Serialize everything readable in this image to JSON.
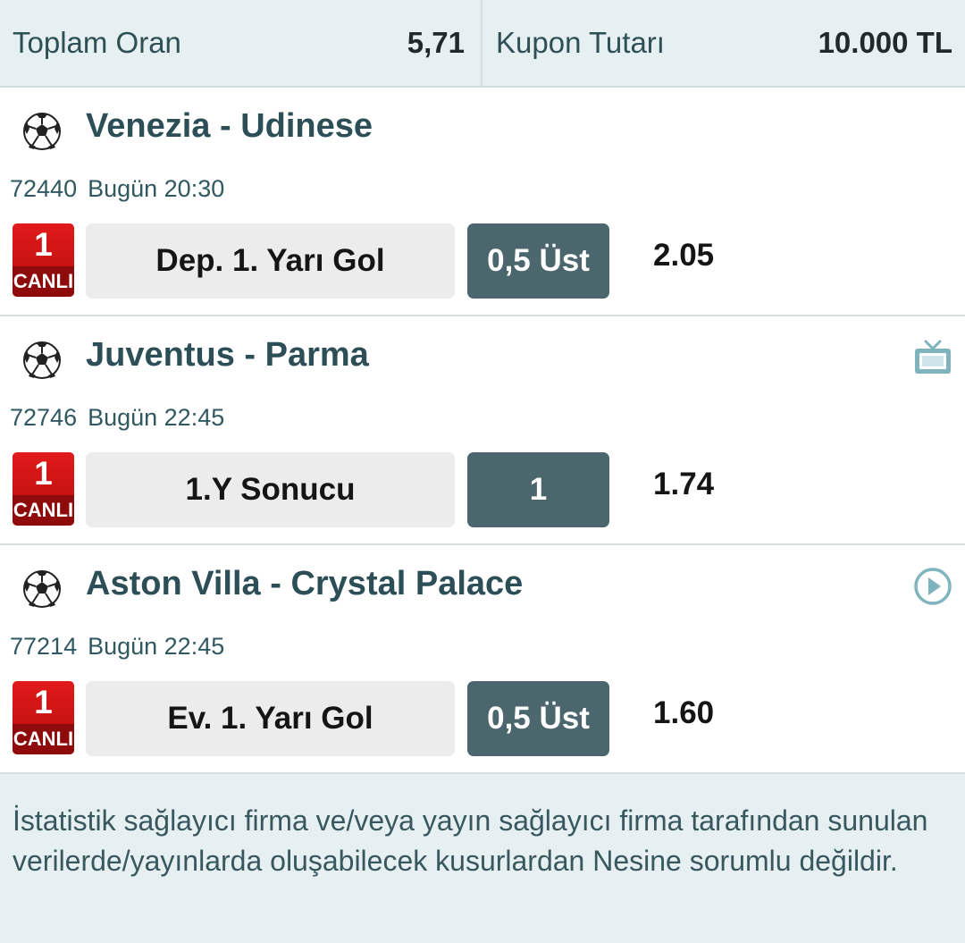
{
  "summary": {
    "total_odds_label": "Toplam Oran",
    "total_odds_value": "5,71",
    "coupon_amount_label": "Kupon Tutarı",
    "coupon_amount_value": "10.000 TL"
  },
  "matches": [
    {
      "title": "Venezia - Udinese",
      "code": "72440",
      "time": "Bugün 20:30",
      "live_number": "1",
      "live_label": "CANLI",
      "market": "Dep. 1. Yarı Gol",
      "pick": "0,5 Üst",
      "odd": "2.05",
      "extra_icon": ""
    },
    {
      "title": "Juventus - Parma",
      "code": "72746",
      "time": "Bugün 22:45",
      "live_number": "1",
      "live_label": "CANLI",
      "market": "1.Y Sonucu",
      "pick": "1",
      "odd": "1.74",
      "extra_icon": "tv-icon"
    },
    {
      "title": "Aston Villa - Crystal Palace",
      "code": "77214",
      "time": "Bugün 22:45",
      "live_number": "1",
      "live_label": "CANLI",
      "market": "Ev. 1. Yarı Gol",
      "pick": "0,5 Üst",
      "odd": "1.60",
      "extra_icon": "play-circle-icon"
    }
  ],
  "icons": {
    "sport": "soccer-ball-icon"
  },
  "colors": {
    "accent": "#4b666d",
    "live_red": "#d01515",
    "title": "#2c4e56",
    "panel_bg": "#e6eff1"
  },
  "footer": {
    "disclaimer": "İstatistik sağlayıcı firma ve/veya yayın sağlayıcı firma tarafından sunulan verilerde/yayınlarda oluşabilecek kusurlardan Nesine sorumlu değildir."
  }
}
